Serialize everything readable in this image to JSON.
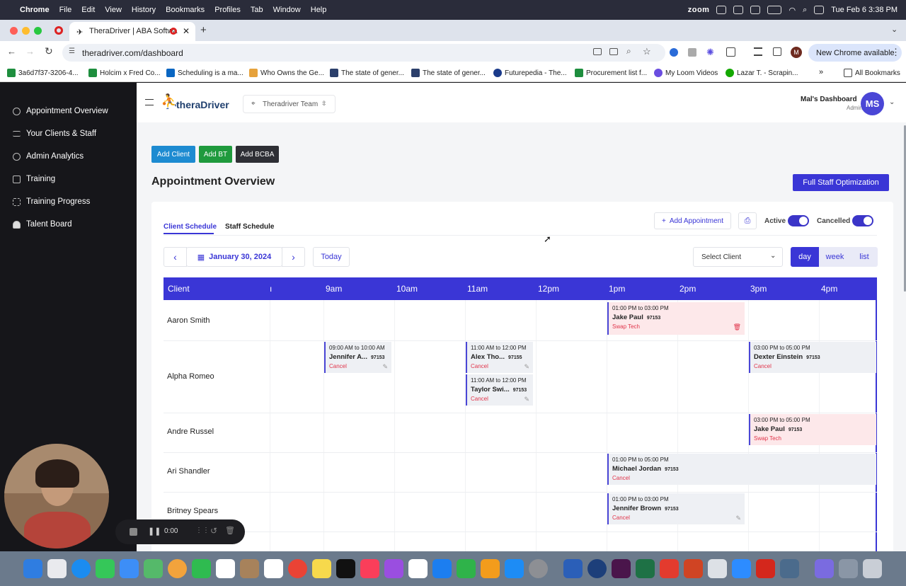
{
  "menubar": {
    "app": "Chrome",
    "items": [
      "File",
      "Edit",
      "View",
      "History",
      "Bookmarks",
      "Profiles",
      "Tab",
      "Window",
      "Help"
    ],
    "zoom": "zoom",
    "datetime": "Tue Feb 6  3:38 PM"
  },
  "browser": {
    "tab_title": "TheraDriver | ABA Softwa",
    "url": "theradriver.com/dashboard",
    "new_chrome": "New Chrome available",
    "avatar": "M"
  },
  "bookmarks": [
    "3a6d7f37-3206-4...",
    "Holcim x Fred Co...",
    "Scheduling is a ma...",
    "Who Owns the Ge...",
    "The state of gener...",
    "The state of gener...",
    "Futurepedia - The...",
    "Procurement list f...",
    "My Loom Videos",
    "Lazar T. - Scrapin..."
  ],
  "bookmarks_all": "All Bookmarks",
  "sidebar": {
    "items": [
      "Appointment Overview",
      "Your Clients & Staff",
      "Admin Analytics",
      "Training",
      "Training Progress",
      "Talent Board"
    ]
  },
  "topbar": {
    "brand": "theraDriver",
    "team": "Theradriver Team",
    "dashboard_title": "Mal's Dashboard",
    "role": "Admin",
    "initials": "MS"
  },
  "actions": {
    "add_client": "Add Client",
    "add_bt": "Add BT",
    "add_bcba": "Add BCBA"
  },
  "page": {
    "title": "Appointment Overview",
    "full_staff": "Full Staff Optimization"
  },
  "card": {
    "tab_client": "Client Schedule",
    "tab_staff": "Staff Schedule",
    "add_appointment": "Add Appointment",
    "active": "Active",
    "cancelled": "Cancelled",
    "date": "January 30, 2024",
    "today": "Today",
    "select_client": "Select Client",
    "views": [
      "day",
      "week",
      "list"
    ]
  },
  "grid": {
    "client_header": "Client",
    "hours": [
      "9am",
      "10am",
      "11am",
      "12pm",
      "1pm",
      "2pm",
      "3pm",
      "4pm"
    ],
    "clients": [
      "Aaron Smith",
      "Alpha Romeo",
      "Andre Russel",
      "Ari Shandler",
      "Britney Spears"
    ]
  },
  "appointments": [
    {
      "time": "01:00 PM to 03:00 PM",
      "name": "Jake Paul",
      "code": "97153",
      "action": "Swap Tech"
    },
    {
      "time": "09:00 AM to 10:00 AM",
      "name": "Jennifer A...",
      "code": "97153",
      "action": "Cancel"
    },
    {
      "time": "11:00 AM to 12:00 PM",
      "name": "Alex Tho...",
      "code": "97155",
      "action": "Cancel"
    },
    {
      "time": "11:00 AM to 12:00 PM",
      "name": "Taylor Swi...",
      "code": "97153",
      "action": "Cancel"
    },
    {
      "time": "03:00 PM to 05:00 PM",
      "name": "Dexter Einstein",
      "code": "97153",
      "action": "Cancel"
    },
    {
      "time": "03:00 PM to 05:00 PM",
      "name": "Jake Paul",
      "code": "97153",
      "action": "Swap Tech"
    },
    {
      "time": "01:00 PM to 05:00 PM",
      "name": "Michael Jordan",
      "code": "97153",
      "action": "Cancel"
    },
    {
      "time": "01:00 PM to 03:00 PM",
      "name": "Jennifer Brown",
      "code": "97153",
      "action": "Cancel"
    }
  ],
  "recorder": {
    "time": "0:00"
  },
  "colors": {
    "primary": "#3a36d6",
    "add_client": "#1d8bd1",
    "add_bt": "#1f9a3d",
    "add_bcba": "#2e2f35",
    "cancel": "#e0344a"
  }
}
